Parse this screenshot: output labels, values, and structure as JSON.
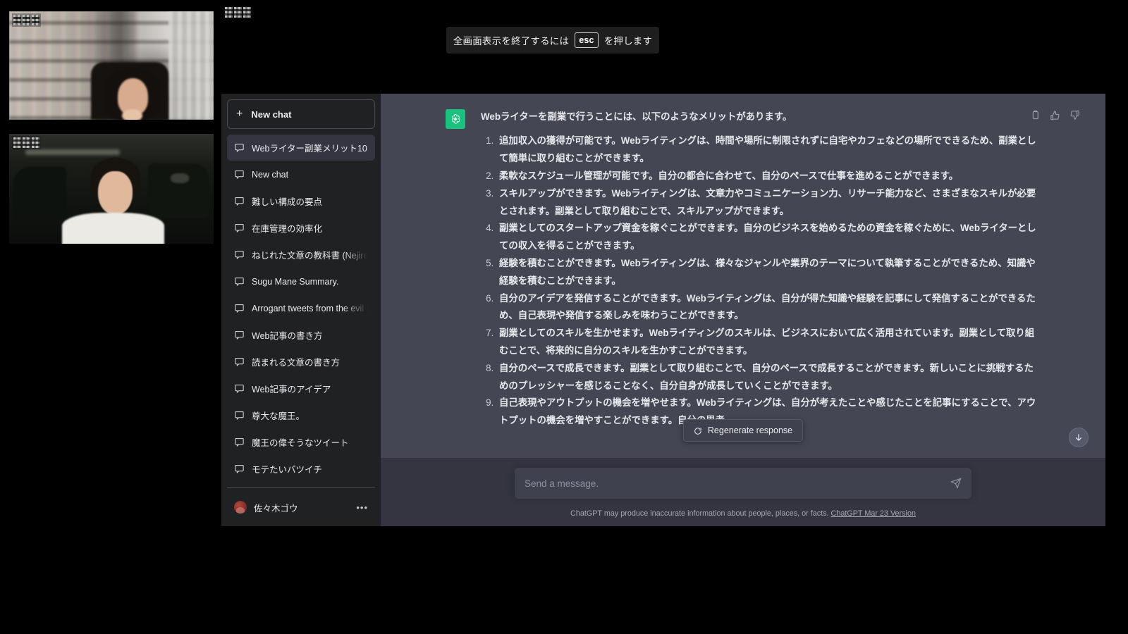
{
  "fullscreen_toast": {
    "prefix": "全画面表示を終了するには",
    "key": "esc",
    "suffix": "を押します"
  },
  "sidebar": {
    "new_chat_label": "New chat",
    "chats": [
      {
        "title": "Webライター副業メリット10",
        "active": true
      },
      {
        "title": "New chat",
        "active": false
      },
      {
        "title": "難しい構成の要点",
        "active": false
      },
      {
        "title": "在庫管理の効率化",
        "active": false
      },
      {
        "title": "ねじれた文章の教科書 (Nejireta",
        "active": false
      },
      {
        "title": "Sugu Mane Summary.",
        "active": false
      },
      {
        "title": "Arrogant tweets from the evil k",
        "active": false
      },
      {
        "title": "Web記事の書き方",
        "active": false
      },
      {
        "title": "読まれる文章の書き方",
        "active": false
      },
      {
        "title": "Web記事のアイデア",
        "active": false
      },
      {
        "title": "尊大な魔王。",
        "active": false
      },
      {
        "title": "魔王の偉そうなツイート",
        "active": false
      },
      {
        "title": "モテたいバツイチ",
        "active": false
      }
    ],
    "user_name": "佐々木ゴウ",
    "user_menu_dots": "•••"
  },
  "conversation": {
    "intro": "Webライターを副業で行うことには、以下のようなメリットがあります。",
    "items": [
      "追加収入の獲得が可能です。Webライティングは、時間や場所に制限されずに自宅やカフェなどの場所でできるため、副業として簡単に取り組むことができます。",
      "柔軟なスケジュール管理が可能です。自分の都合に合わせて、自分のペースで仕事を進めることができます。",
      "スキルアップができます。Webライティングは、文章力やコミュニケーション力、リサーチ能力など、さまざまなスキルが必要とされます。副業として取り組むことで、スキルアップができます。",
      "副業としてのスタートアップ資金を稼ぐことができます。自分のビジネスを始めるための資金を稼ぐために、Webライターとしての収入を得ることができます。",
      "経験を積むことができます。Webライティングは、様々なジャンルや業界のテーマについて執筆することができるため、知識や経験を積むことができます。",
      "自分のアイデアを発信することができます。Webライティングは、自分が得た知識や経験を記事にして発信することができるため、自己表現や発信する楽しみを味わうことができます。",
      "副業としてのスキルを生かせます。Webライティングのスキルは、ビジネスにおいて広く活用されています。副業として取り組むことで、将来的に自分のスキルを生かすことができます。",
      "自分のペースで成長できます。副業として取り組むことで、自分のペースで成長することができます。新しいことに挑戦するためのプレッシャーを感じることなく、自分自身が成長していくことができます。",
      "自己表現やアウトプットの機会を増やせます。Webライティングは、自分が考えたことや感じたことを記事にすることで、アウトプットの機会を増やすことができます。自分の思考"
    ]
  },
  "actions": {
    "regenerate_label": "Regenerate response"
  },
  "composer": {
    "placeholder": "Send a message.",
    "value": ""
  },
  "footer": {
    "disclaimer": "ChatGPT may produce inaccurate information about people, places, or facts.",
    "version_link": "ChatGPT Mar 23 Version"
  },
  "colors": {
    "brand_green": "#19c37d",
    "sidebar_bg": "#202123",
    "main_bg": "#343541",
    "message_bg": "#444654",
    "composer_bg": "#40414f"
  }
}
